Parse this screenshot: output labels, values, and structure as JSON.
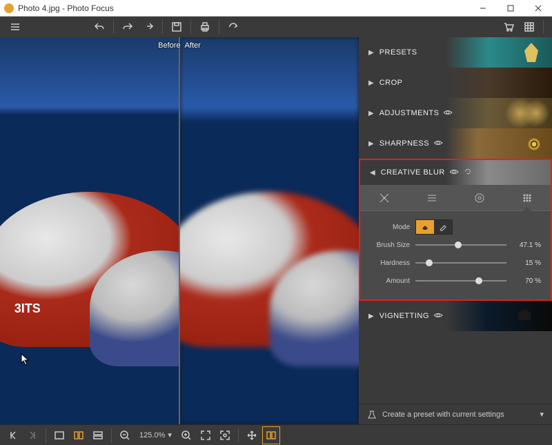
{
  "window": {
    "title": "Photo 4.jpg - Photo Focus"
  },
  "canvas": {
    "before_label": "Before",
    "after_label": "After",
    "hull_text": "3ITS"
  },
  "panels": {
    "presets": "PRESETS",
    "crop": "CROP",
    "adjustments": "ADJUSTMENTS",
    "sharpness": "SHARPNESS",
    "creative_blur": "CREATIVE BLUR",
    "vignetting": "VIGNETTING"
  },
  "blur": {
    "mode_label": "Mode",
    "brush_size_label": "Brush Size",
    "brush_size_value": "47.1 %",
    "brush_size_pct": 47.1,
    "hardness_label": "Hardness",
    "hardness_value": "15 %",
    "hardness_pct": 15,
    "amount_label": "Amount",
    "amount_value": "70 %",
    "amount_pct": 70
  },
  "bottom": {
    "zoom": "125.0%"
  },
  "footer": {
    "create_preset": "Create a preset with current settings"
  }
}
